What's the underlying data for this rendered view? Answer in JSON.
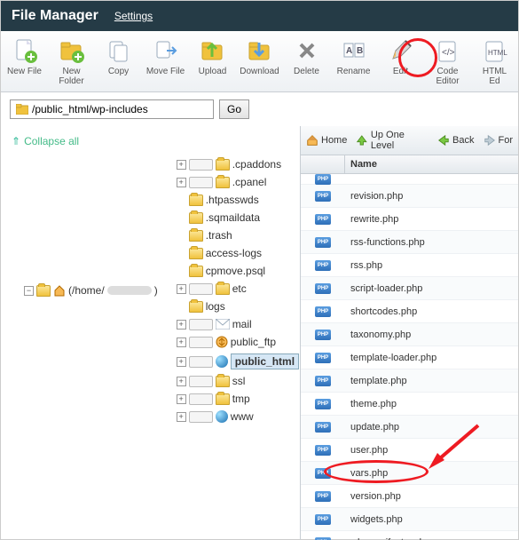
{
  "header": {
    "title": "File Manager",
    "settings": "Settings"
  },
  "toolbar": [
    {
      "id": "new-file",
      "label": "New File"
    },
    {
      "id": "new-folder",
      "label": "New\nFolder"
    },
    {
      "id": "copy",
      "label": "Copy"
    },
    {
      "id": "move-file",
      "label": "Move File"
    },
    {
      "id": "upload",
      "label": "Upload"
    },
    {
      "id": "download",
      "label": "Download"
    },
    {
      "id": "delete",
      "label": "Delete"
    },
    {
      "id": "rename",
      "label": "Rename"
    },
    {
      "id": "edit",
      "label": "Edit"
    },
    {
      "id": "code-editor",
      "label": "Code\nEditor"
    },
    {
      "id": "html-editor",
      "label": "HTML\nEd"
    }
  ],
  "path": {
    "value": "/public_html/wp-includes",
    "go": "Go"
  },
  "collapse_label": "Collapse all",
  "tree": {
    "root_label": "(/home/",
    "root_redacted": true,
    "nodes": [
      {
        "label": ".cpaddons",
        "exp": "+",
        "dotted": true
      },
      {
        "label": ".cpanel",
        "exp": "+",
        "dotted": true
      },
      {
        "label": ".htpasswds",
        "exp": "",
        "dotted": false
      },
      {
        "label": ".sqmaildata",
        "exp": "",
        "dotted": false
      },
      {
        "label": ".trash",
        "exp": "",
        "dotted": false
      },
      {
        "label": "access-logs",
        "exp": "",
        "dotted": false
      },
      {
        "label": "cpmove.psql",
        "exp": "",
        "dotted": false
      },
      {
        "label": "etc",
        "exp": "+",
        "dotted": true
      },
      {
        "label": "logs",
        "exp": "",
        "dotted": false
      },
      {
        "label": "mail",
        "exp": "+",
        "dotted": true,
        "icon": "mail"
      },
      {
        "label": "public_ftp",
        "exp": "+",
        "dotted": true,
        "icon": "ftp"
      },
      {
        "label": "public_html",
        "exp": "+",
        "dotted": true,
        "icon": "globe",
        "selected": true
      },
      {
        "label": "ssl",
        "exp": "+",
        "dotted": true
      },
      {
        "label": "tmp",
        "exp": "+",
        "dotted": true
      },
      {
        "label": "www",
        "exp": "+",
        "dotted": true,
        "icon": "globe"
      }
    ]
  },
  "nav": {
    "home": "Home",
    "up": "Up One Level",
    "back": "Back",
    "forward": "For"
  },
  "columns": {
    "name": "Name"
  },
  "files": [
    {
      "name": "revision.php",
      "type": "PHP"
    },
    {
      "name": "rewrite.php",
      "type": "PHP"
    },
    {
      "name": "rss-functions.php",
      "type": "PHP"
    },
    {
      "name": "rss.php",
      "type": "PHP"
    },
    {
      "name": "script-loader.php",
      "type": "PHP"
    },
    {
      "name": "shortcodes.php",
      "type": "PHP"
    },
    {
      "name": "taxonomy.php",
      "type": "PHP"
    },
    {
      "name": "template-loader.php",
      "type": "PHP"
    },
    {
      "name": "template.php",
      "type": "PHP"
    },
    {
      "name": "theme.php",
      "type": "PHP"
    },
    {
      "name": "update.php",
      "type": "PHP"
    },
    {
      "name": "user.php",
      "type": "PHP"
    },
    {
      "name": "vars.php",
      "type": "PHP"
    },
    {
      "name": "version.php",
      "type": "PHP"
    },
    {
      "name": "widgets.php",
      "type": "PHP"
    },
    {
      "name": "wlwmanifest.xml",
      "type": "XML"
    }
  ],
  "annotations": {
    "edit_circled": true,
    "version_circled": true
  }
}
